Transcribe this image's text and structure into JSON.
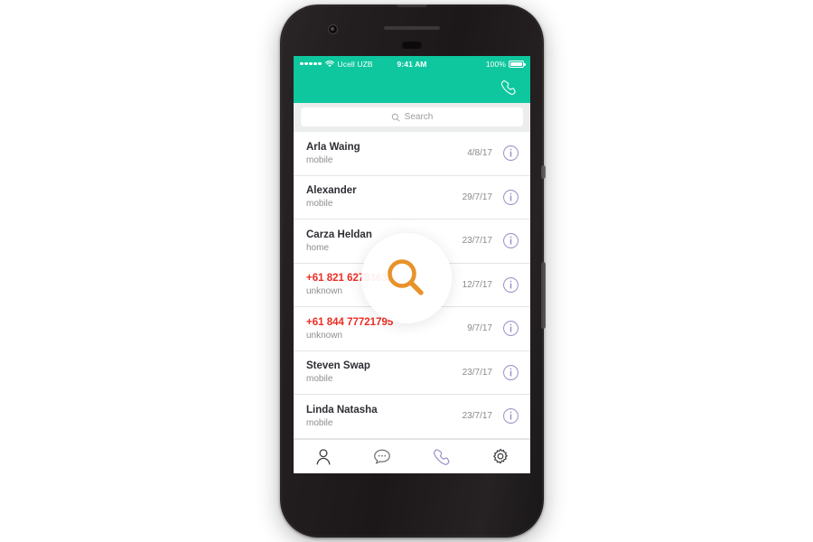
{
  "theme": {
    "teal": "#0ec79e",
    "accent_purple": "#9b93c9",
    "flag_red": "#ee2d23",
    "magnifier_orange": "#e8922a",
    "device_body": "#231f20"
  },
  "device": {
    "name": "smartphone-mockup",
    "hardware": {
      "earpiece": "earpiece-speaker",
      "front_camera": "front-camera",
      "proximity_sensor": "proximity-sensor",
      "power_button": "power-button",
      "volume_rocker": "volume-rocker"
    }
  },
  "status_bar": {
    "signal_dots": 5,
    "wifi_icon": "wifi-icon",
    "carrier": "Ucell UZB",
    "time": "9:41 AM",
    "battery_percent": "100%",
    "battery_icon": "battery-full-icon"
  },
  "header": {
    "call_icon": "phone-handset-icon"
  },
  "search": {
    "icon": "search-icon",
    "value": "",
    "placeholder": "Search"
  },
  "contacts": {
    "info_icon": "info-circle-icon",
    "rows": [
      {
        "title": "Arla Waing",
        "subtitle": "mobile",
        "date": "4/8/17",
        "flagged": false
      },
      {
        "title": "Alexander",
        "subtitle": "mobile",
        "date": "29/7/17",
        "flagged": false
      },
      {
        "title": "Carza Heldan",
        "subtitle": "home",
        "date": "23/7/17",
        "flagged": false
      },
      {
        "title": "+61 821 62783632",
        "subtitle": "unknown",
        "date": "12/7/17",
        "flagged": true
      },
      {
        "title": "+61 844 77721795",
        "subtitle": "unknown",
        "date": "9/7/17",
        "flagged": true
      },
      {
        "title": "Steven Swap",
        "subtitle": "mobile",
        "date": "23/7/17",
        "flagged": false
      },
      {
        "title": "Linda Natasha",
        "subtitle": "mobile",
        "date": "23/7/17",
        "flagged": false
      }
    ]
  },
  "magnifier": {
    "icon": "magnifying-glass-icon"
  },
  "tab_bar": {
    "items": [
      {
        "name": "tab-contacts",
        "icon": "person-icon",
        "active": false
      },
      {
        "name": "tab-messages",
        "icon": "chat-bubble-icon",
        "active": false
      },
      {
        "name": "tab-calls",
        "icon": "phone-handset-icon",
        "active": true
      },
      {
        "name": "tab-settings",
        "icon": "gear-icon",
        "active": false
      }
    ]
  }
}
